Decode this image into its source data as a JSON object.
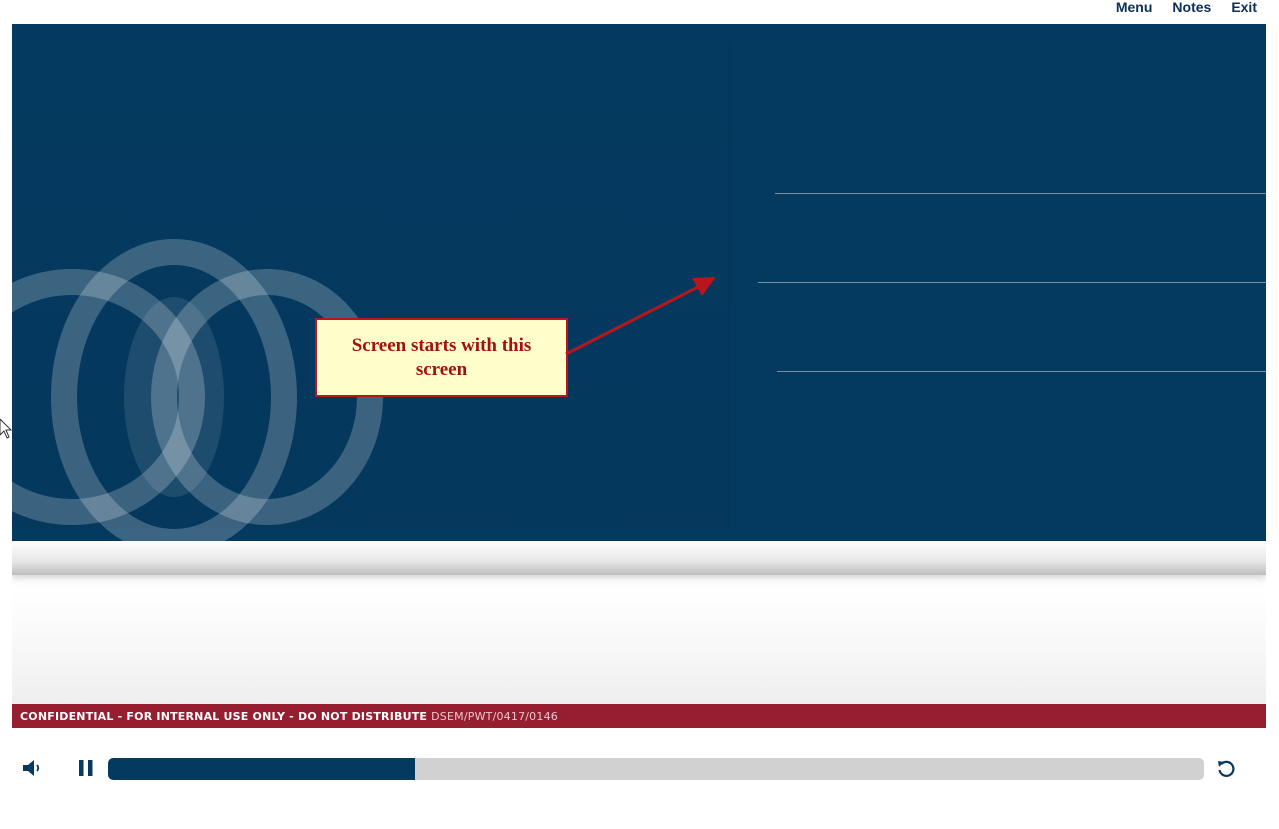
{
  "topnav": {
    "menu": "Menu",
    "notes": "Notes",
    "exit": "Exit"
  },
  "callout": {
    "text": "Screen starts with this screen"
  },
  "footer": {
    "confidential": "CONFIDENTIAL - FOR INTERNAL USE ONLY - DO NOT DISTRIBUTE",
    "code": "DSEM/PWT/0417/0146"
  },
  "player": {
    "progress_fraction": 0.28,
    "controls": [
      "volume-icon",
      "pause-icon",
      "replay-icon"
    ]
  },
  "colors": {
    "slide_bg": "#053a60",
    "confidential_bar": "#951f30",
    "callout_bg": "#ffffcc",
    "callout_border": "#b8161c",
    "progress_fill": "#053a60",
    "progress_track": "#d1d1d1"
  }
}
